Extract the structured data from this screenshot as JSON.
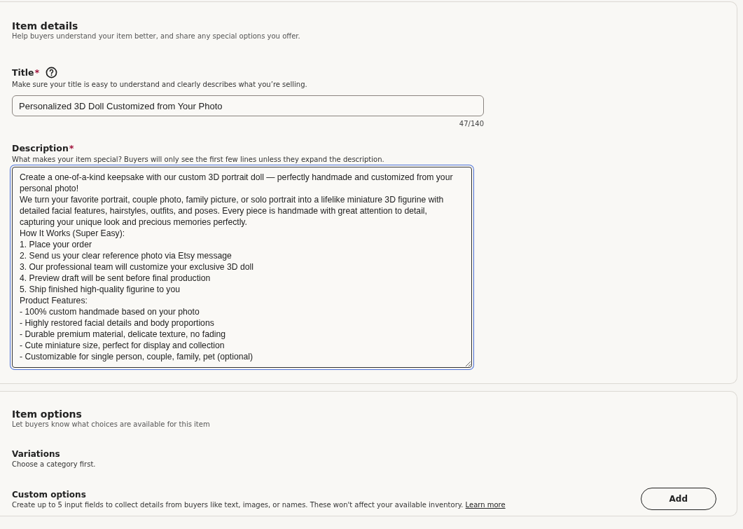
{
  "item_details": {
    "heading": "Item details",
    "subtitle": "Help buyers understand your item better, and share any special options you offer.",
    "title_field": {
      "label": "Title",
      "required_mark": "*",
      "hint": "Make sure your title is easy to understand and clearly describes what you’re selling.",
      "value": "Personalized 3D Doll Customized from Your Photo",
      "counter": "47/140"
    },
    "description_field": {
      "label": "Description",
      "required_mark": "*",
      "hint": "What makes your item special? Buyers will only see the first few lines unless they expand the description.",
      "focused": true,
      "value": "Create a one-of-a-kind keepsake with our custom 3D portrait doll — perfectly handmade and customized from your personal photo!\nWe turn your favorite portrait, couple photo, family picture, or solo portrait into a lifelike miniature 3D figurine with detailed facial features, hairstyles, outfits, and poses. Every piece is handmade with great attention to detail, capturing your unique look and precious memories perfectly.\nHow It Works (Super Easy):\n1. Place your order\n2. Send us your clear reference photo via Etsy message\n3. Our professional team will customize your exclusive 3D doll\n4. Preview draft will be sent before final production\n5. Ship finished high-quality figurine to you\nProduct Features:\n- 100% custom handmade based on your photo\n- Highly restored facial details and body proportions\n- Durable premium material, delicate texture, no fading\n- Cute miniature size, perfect for display and collection\n- Customizable for single person, couple, family, pet (optional)"
    }
  },
  "item_options": {
    "heading": "Item options",
    "subtitle": "Let buyers know what choices are available for this item",
    "variations": {
      "label": "Variations",
      "hint": "Choose a category first."
    },
    "custom_options": {
      "label": "Custom options",
      "hint": "Create up to 5 input fields to collect details from buyers like text, images, or names. These won't affect your available inventory.",
      "link": "Learn more",
      "button": "Add"
    }
  }
}
